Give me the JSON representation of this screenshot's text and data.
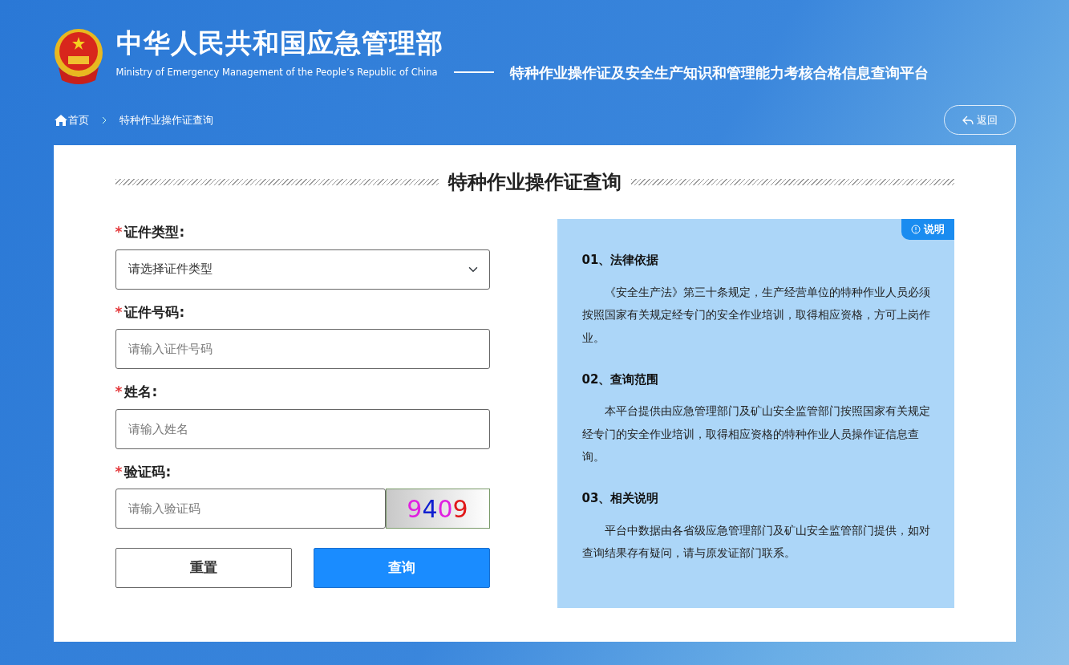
{
  "header": {
    "title": "中华人民共和国应急管理部",
    "subtitle": "Ministry of Emergency Management of the People’s Republic of China",
    "platform": "特种作业操作证及安全生产知识和管理能力考核合格信息查询平台"
  },
  "breadcrumb": [
    {
      "label": "首页",
      "kind": "home"
    },
    {
      "label": "特种作业操作证查询",
      "kind": "page"
    }
  ],
  "back_button": "返回",
  "form": {
    "title": "特种作业操作证查询",
    "fields": [
      {
        "label": "证件类型:",
        "required_mark": "*",
        "kind": "select",
        "placeholder": "请选择证件类型"
      },
      {
        "label": "证件号码:",
        "required_mark": "*",
        "kind": "input",
        "placeholder": "请输入证件号码"
      },
      {
        "label": "姓名:",
        "required_mark": "*",
        "kind": "input",
        "placeholder": "请输入姓名"
      },
      {
        "label": "验证码:",
        "required_mark": "*",
        "kind": "captcha",
        "placeholder": "请输入验证码"
      }
    ],
    "captcha": [
      {
        "text": "9",
        "color": "#e020e0"
      },
      {
        "text": "4",
        "color": "#1020d0"
      },
      {
        "text": "0",
        "color": "#e020e0"
      },
      {
        "text": "9",
        "color": "#e01818"
      }
    ],
    "buttons": [
      {
        "label": "重置",
        "kind": "reset"
      },
      {
        "label": "查询",
        "kind": "submit"
      }
    ]
  },
  "info": {
    "tag": "说明",
    "sections": [
      {
        "heading": "01、法律依据",
        "body": "《安全生产法》第三十条规定，生产经营单位的特种作业人员必须按照国家有关规定经专门的安全作业培训，取得相应资格，方可上岗作业。"
      },
      {
        "heading": "02、查询范围",
        "body": "本平台提供由应急管理部门及矿山安全监管部门按照国家有关规定经专门的安全作业培训，取得相应资格的特种作业人员操作证信息查询。"
      },
      {
        "heading": "03、相关说明",
        "body": "平台中数据由各省级应急管理部门及矿山安全监管部门提供，如对查询结果存有疑问，请与原发证部门联系。"
      }
    ]
  }
}
